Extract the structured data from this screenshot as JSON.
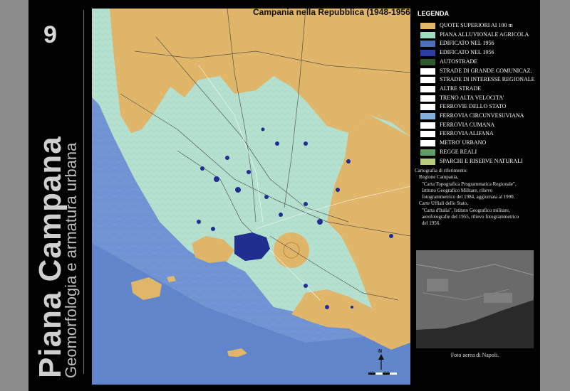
{
  "sheet": {
    "number": "9",
    "title": "Piana Campana",
    "subtitle": "Geomorfologia e armatura urbana"
  },
  "map": {
    "title": "Campania nella Repubblica (1948-1956)",
    "north_label": "N",
    "colors": {
      "sea": "#6f93d4",
      "sea_deep": "#5f86cc",
      "plain": "#b4e0cf",
      "hills": "#e0b66a",
      "urban": "#1f2e8f"
    }
  },
  "legend": {
    "title": "LEGENDA",
    "items": [
      {
        "label": "QUOTE SUPERIORI AI 100 m",
        "swatch": "#e0b66a"
      },
      {
        "label": "PIANA ALLUVIONALE AGRICOLA",
        "swatch": "#9fdcc2"
      },
      {
        "label": "EDIFICATO NEL 1956",
        "swatch": "#4b6fb8"
      },
      {
        "label": "EDIFICATO NEL 1956",
        "swatch": "#2b3fa3"
      },
      {
        "label": "AUTOSTRADE",
        "swatch": "#2d5a2d"
      },
      {
        "label": "STRADE DI GRANDE COMUNICAZ.",
        "swatch": "#ffffff"
      },
      {
        "label": "STRADE DI INTERESSE REGIONALE",
        "swatch": "#ffffff"
      },
      {
        "label": "ALTRE STRADE",
        "swatch": "#ffffff"
      },
      {
        "label": "TRENO ALTA VELOCITA'",
        "swatch": "#ffffff"
      },
      {
        "label": "FERROVIE DELLO STATO",
        "swatch": "#ffffff"
      },
      {
        "label": "FERROVIA CIRCUNVESUVIANA",
        "swatch": "#7fb0e0"
      },
      {
        "label": "FERROVIA CUMANA",
        "swatch": "#ffffff"
      },
      {
        "label": "FERROVIA ALIFANA",
        "swatch": "#ffffff"
      },
      {
        "label": "METRO' URBANO",
        "swatch": "#ffffff"
      },
      {
        "label": "REGGE REALI",
        "swatch": "#5fa060"
      },
      {
        "label": "SPARCHI E RISERVE NATURALI",
        "swatch": "#b7cf7a"
      }
    ]
  },
  "cartography": {
    "lines": [
      "Cartografia di riferimento:",
      "Regione Campania,",
      "\"Carta Topografica Programmatica Regionale\",",
      "Istituto Geografico Militare, rilievo",
      "fotogrammetrico del 1984, aggiornata al 1990.",
      "Carte Uffiali dello Stato,",
      "\"Carta d'Italia\", Istituto Geografico militare,",
      "aerofotografie del 1955, rilievo fotogrammetrico",
      "del 1956."
    ]
  },
  "photo": {
    "caption": "Foto aerea di Napoli."
  }
}
